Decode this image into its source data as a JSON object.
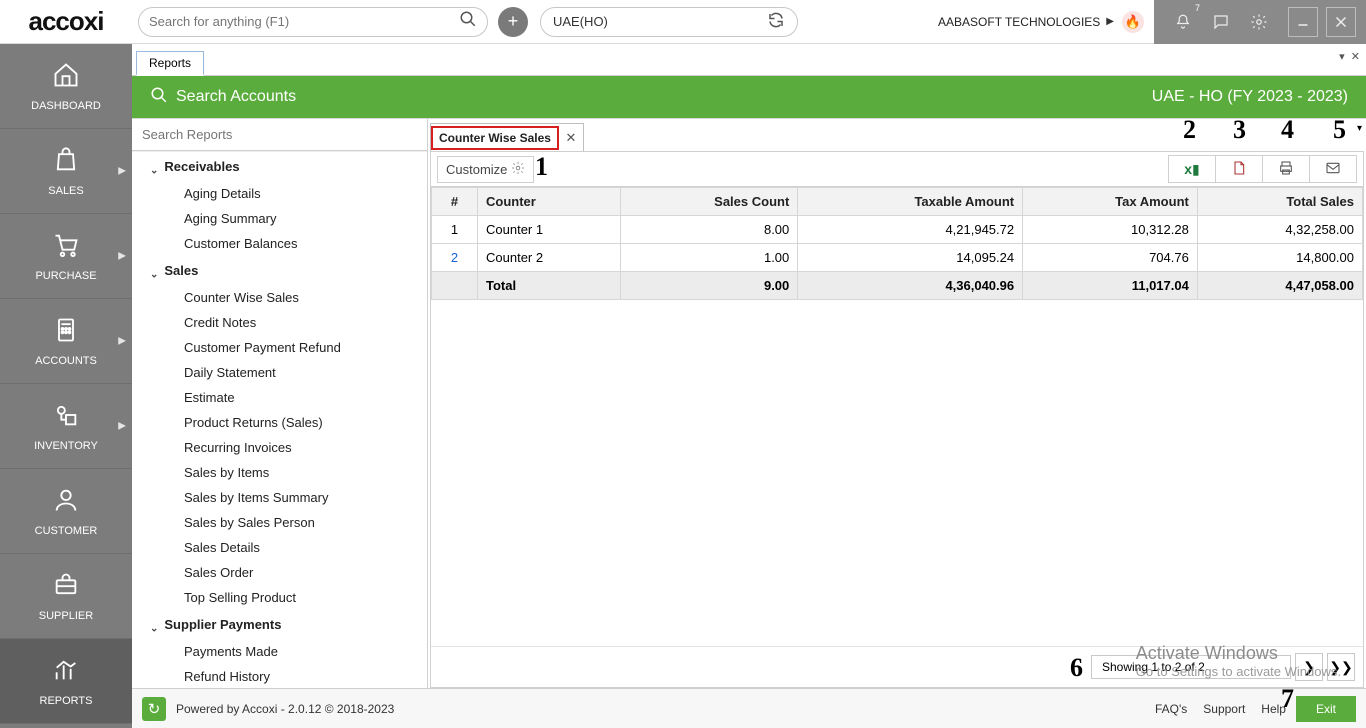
{
  "top": {
    "search_placeholder": "Search for anything (F1)",
    "location": "UAE(HO)",
    "org": "AABASOFT TECHNOLOGIES",
    "notif_count": "7"
  },
  "nav": {
    "items": [
      {
        "label": "DASHBOARD"
      },
      {
        "label": "SALES"
      },
      {
        "label": "PURCHASE"
      },
      {
        "label": "ACCOUNTS"
      },
      {
        "label": "INVENTORY"
      },
      {
        "label": "CUSTOMER"
      },
      {
        "label": "SUPPLIER"
      },
      {
        "label": "REPORTS"
      }
    ]
  },
  "reports_tab": "Reports",
  "greenbar": {
    "title": "Search Accounts",
    "right": "UAE - HO (FY 2023 - 2023)"
  },
  "side": {
    "search_placeholder": "Search Reports",
    "groups": [
      {
        "name": "Receivables",
        "items": [
          "Aging Details",
          "Aging Summary",
          "Customer Balances"
        ]
      },
      {
        "name": "Sales",
        "items": [
          "Counter Wise Sales",
          "Credit Notes",
          "Customer Payment Refund",
          "Daily Statement",
          "Estimate",
          "Product Returns (Sales)",
          "Recurring Invoices",
          "Sales by Items",
          "Sales by Items Summary",
          "Sales by Sales Person",
          "Sales Details",
          "Sales Order",
          "Top Selling Product"
        ]
      },
      {
        "name": "Supplier Payments",
        "items": [
          "Payments Made",
          "Refund History"
        ]
      }
    ]
  },
  "tab": {
    "label": "Counter Wise Sales"
  },
  "toolbar": {
    "customize": "Customize"
  },
  "annotations": [
    "1",
    "2",
    "3",
    "4",
    "5",
    "6",
    "7"
  ],
  "table": {
    "headers": [
      "#",
      "Counter",
      "Sales Count",
      "Taxable Amount",
      "Tax Amount",
      "Total Sales"
    ],
    "rows": [
      {
        "idx": "1",
        "counter": "Counter 1",
        "count": "8.00",
        "taxable": "4,21,945.72",
        "tax": "10,312.28",
        "total": "4,32,258.00"
      },
      {
        "idx": "2",
        "counter": "Counter 2",
        "count": "1.00",
        "taxable": "14,095.24",
        "tax": "704.76",
        "total": "14,800.00"
      }
    ],
    "total": {
      "label": "Total",
      "count": "9.00",
      "taxable": "4,36,040.96",
      "tax": "11,017.04",
      "total": "4,47,058.00"
    }
  },
  "pager": {
    "info": "Showing 1 to 2 of 2"
  },
  "watermark": {
    "t": "Activate Windows",
    "s": "Go to Settings to activate Windows."
  },
  "footer": {
    "powered": "Powered by Accoxi - 2.0.12 © 2018-2023",
    "links": [
      "FAQ's",
      "Support",
      "Help"
    ],
    "exit": "Exit"
  }
}
